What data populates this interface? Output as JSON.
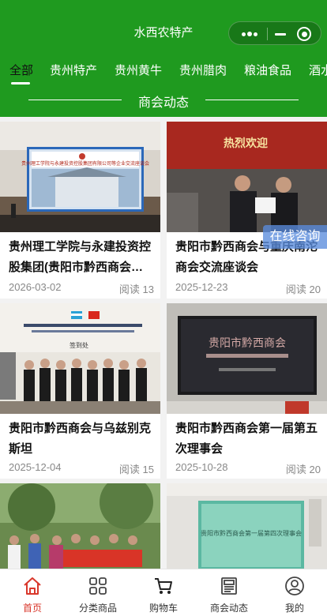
{
  "header": {
    "title": "水西农特产",
    "tabs": [
      "全部",
      "贵州特产",
      "贵州黄牛",
      "贵州腊肉",
      "粮油食品",
      "酒水"
    ],
    "active_tab": "全部",
    "section_title": "商会动态",
    "colors": {
      "brand_green": "#1f9a1f"
    }
  },
  "articles": [
    {
      "title": "贵州理工学院与永建投资控股集团(贵阳市黔西商会…",
      "date": "2026-03-02",
      "views": "阅读 13",
      "banner_text": "贵州理工学院与永建投资控股集团有限公司等企业交流座谈会"
    },
    {
      "title": "贵阳市黔西商会与重庆南沱商会交流座谈会",
      "date": "2025-12-23",
      "views": "阅读 20",
      "banner_text": "热烈欢迎"
    },
    {
      "title": "贵阳市黔西商会与乌兹别克斯坦",
      "date": "2025-12-04",
      "views": "阅读 15",
      "banner_text": "签到处"
    },
    {
      "title": "贵阳市黔西商会第一届第五次理事会",
      "date": "2025-10-28",
      "views": "阅读 20",
      "banner_text": "贵阳市黔西商会"
    },
    {
      "title": "",
      "date": "",
      "views": "",
      "banner_text": ""
    },
    {
      "title": "",
      "date": "",
      "views": "",
      "banner_text": "贵阳市黔西商会第一届第四次理事会"
    }
  ],
  "float_button": "在线咨询",
  "tabbar": [
    {
      "label": "首页",
      "icon": "home-icon",
      "active": true
    },
    {
      "label": "分类商品",
      "icon": "grid-icon",
      "active": false
    },
    {
      "label": "购物车",
      "icon": "cart-icon",
      "active": false
    },
    {
      "label": "商会动态",
      "icon": "news-icon",
      "active": false
    },
    {
      "label": "我的",
      "icon": "user-icon",
      "active": false
    }
  ]
}
